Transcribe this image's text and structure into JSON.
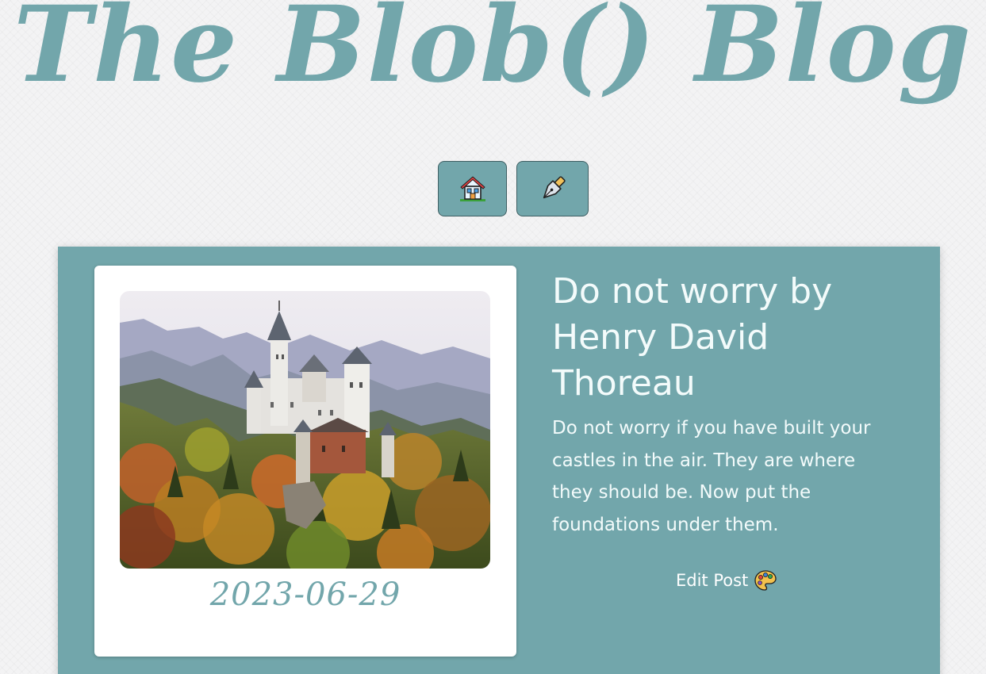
{
  "site": {
    "title": "The Blob() Blog"
  },
  "nav": {
    "items": [
      {
        "icon": "house-icon"
      },
      {
        "icon": "pen-nib-icon"
      }
    ]
  },
  "post": {
    "title": "Do not worry by Henry David Thoreau",
    "body": "Do not worry if you have built your castles in the air. They are where they should be. Now put the foundations under them.",
    "date": "2023-06-29",
    "edit_label": "Edit Post",
    "edit_icon": "palette-icon",
    "image_subject": "castle on forested hill with mountains"
  },
  "colors": {
    "accent": "#72a6ab",
    "card_text": "#f3fbfb",
    "background": "#f3f3f4"
  }
}
